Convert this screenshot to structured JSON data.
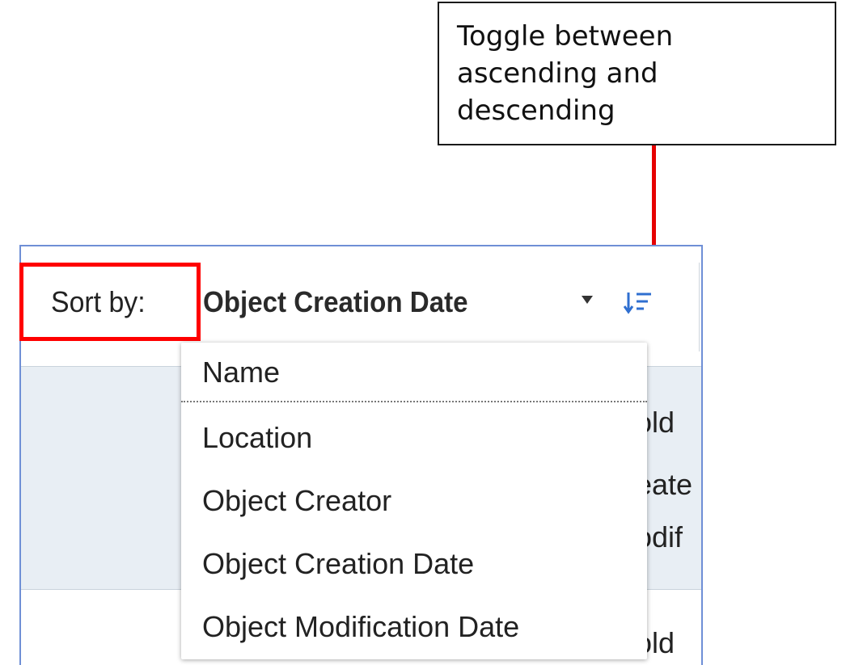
{
  "callout": {
    "text": "Toggle between ascending and descending"
  },
  "toolbar": {
    "sort_label": "Sort by:",
    "sort_value": "Object Creation Date",
    "sort_direction_icon": "sort-descending-icon",
    "dropdown_icon": "caret-down-icon"
  },
  "menu": {
    "items": [
      {
        "label": "Name"
      },
      {
        "label": "Location"
      },
      {
        "label": "Object Creator"
      },
      {
        "label": "Object Creation Date"
      },
      {
        "label": "Object Modification Date"
      }
    ]
  },
  "background_rows": {
    "snippets": [
      "old",
      "eate",
      "odif",
      "old"
    ]
  },
  "colors": {
    "highlight": "#ff0000",
    "arrow": "#e60000",
    "panel_border": "#6f8fd6",
    "row_background": "#e8eef4",
    "icon_blue": "#2f6fd0"
  }
}
